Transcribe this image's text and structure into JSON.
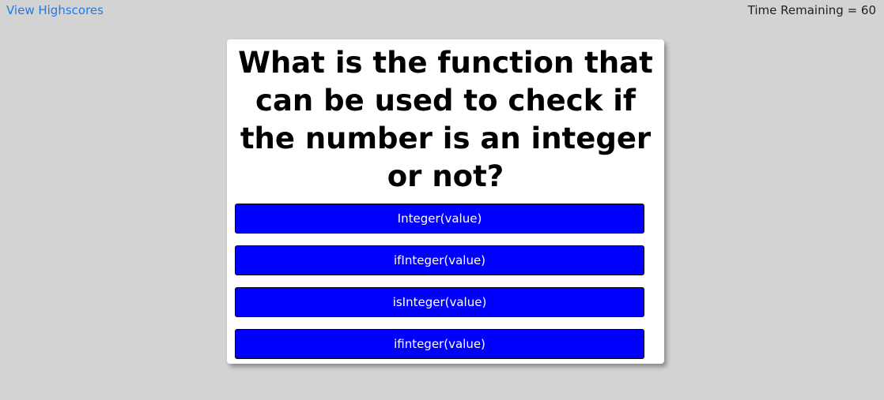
{
  "header": {
    "highscores_label": "View Highscores",
    "timer_text": "Time Remaining = 60"
  },
  "quiz": {
    "question": "What is the function that can be used to check if the number is an integer or not?",
    "answers": [
      "Integer(value)",
      "ifInteger(value)",
      "isInteger(value)",
      "ifinteger(value)"
    ]
  },
  "colors": {
    "background": "#d3d3d3",
    "link": "#1e7be8",
    "answer_button": "#0000ff",
    "card": "#ffffff"
  }
}
